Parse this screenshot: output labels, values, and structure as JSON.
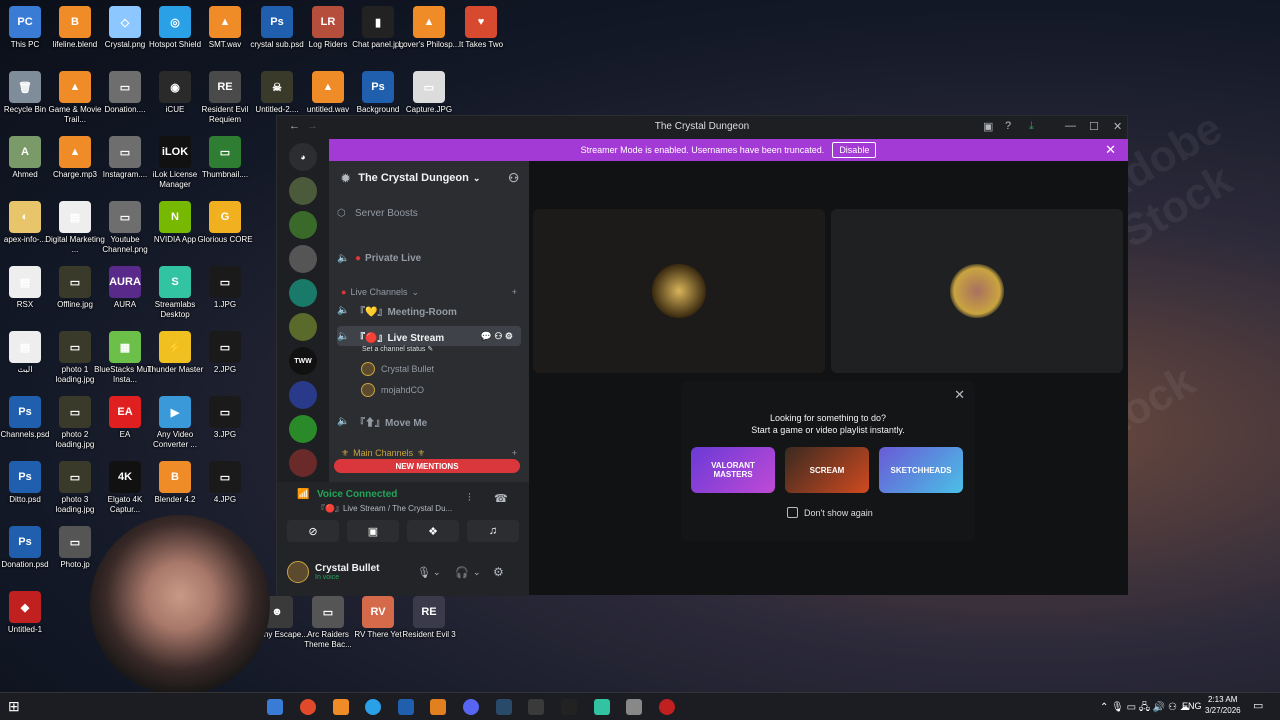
{
  "desktop": {
    "icons": [
      {
        "label": "This PC",
        "color": "#3a7bd5",
        "glyph": "PC"
      },
      {
        "label": "lifeline.blend",
        "color": "#f08c28",
        "glyph": "B"
      },
      {
        "label": "Crystal.png",
        "color": "#8cc8ff",
        "glyph": "◇"
      },
      {
        "label": "Hotspot Shield",
        "color": "#2aa0e6",
        "glyph": "◎"
      },
      {
        "label": "SMT.wav",
        "color": "#f08c28",
        "glyph": "▲"
      },
      {
        "label": "crystal sub.psd",
        "color": "#1f5fae",
        "glyph": "Ps"
      },
      {
        "label": "Log Riders",
        "color": "#b54f3b",
        "glyph": "LR"
      },
      {
        "label": "Chat panel.jpg",
        "color": "#222222",
        "glyph": "▮"
      },
      {
        "label": "Lover's Philosp...",
        "color": "#f08c28",
        "glyph": "▲"
      },
      {
        "label": "It Takes Two",
        "color": "#d84a2f",
        "glyph": "♥"
      },
      {
        "label": "Recycle Bin",
        "color": "#7f8c99",
        "glyph": "🗑"
      },
      {
        "label": "Game & Movie Trail...",
        "color": "#f08c28",
        "glyph": "▲"
      },
      {
        "label": "Donation....",
        "color": "#6e6e6e",
        "glyph": "▭"
      },
      {
        "label": "iCUE",
        "color": "#2a2a2a",
        "glyph": "◉"
      },
      {
        "label": "Resident Evil Requiem",
        "color": "#4a4a4a",
        "glyph": "RE"
      },
      {
        "label": "Untitled-2....",
        "color": "#3a3a2a",
        "glyph": "☠"
      },
      {
        "label": "untitled.wav",
        "color": "#f08c28",
        "glyph": "▲"
      },
      {
        "label": "Background",
        "color": "#1f5fae",
        "glyph": "Ps"
      },
      {
        "label": "Capture.JPG",
        "color": "#dcdcdc",
        "glyph": "▭"
      },
      {
        "label": "Ahmed",
        "color": "#7a9a6a",
        "glyph": "A"
      },
      {
        "label": "Charge.mp3",
        "color": "#f08c28",
        "glyph": "▲"
      },
      {
        "label": "Instagram....",
        "color": "#6e6e6e",
        "glyph": "▭"
      },
      {
        "label": "iLok License Manager",
        "color": "#111111",
        "glyph": "iLOK"
      },
      {
        "label": "Thumbnail....",
        "color": "#2e7d32",
        "glyph": "▭"
      },
      {
        "label": "apex-info-...",
        "color": "#e8c46a",
        "glyph": "◐"
      },
      {
        "label": "Digital Marketing ...",
        "color": "#eeeeee",
        "glyph": "▤"
      },
      {
        "label": "Youtube Channel.png",
        "color": "#6e6e6e",
        "glyph": "▭"
      },
      {
        "label": "NVIDIA App",
        "color": "#76b900",
        "glyph": "N"
      },
      {
        "label": "Glorious CORE",
        "color": "#f0b020",
        "glyph": "G"
      },
      {
        "label": "RSX",
        "color": "#eeeeee",
        "glyph": "▤"
      },
      {
        "label": "Offline.jpg",
        "color": "#3a3a2a",
        "glyph": "▭"
      },
      {
        "label": "AURA",
        "color": "#5a2a8a",
        "glyph": "AURA"
      },
      {
        "label": "Streamlabs Desktop",
        "color": "#31c3a2",
        "glyph": "S"
      },
      {
        "label": "1.JPG",
        "color": "#1a1a1a",
        "glyph": "▭"
      },
      {
        "label": "البث",
        "color": "#eeeeee",
        "glyph": "▤"
      },
      {
        "label": "photo 1 loading.jpg",
        "color": "#3a3a2a",
        "glyph": "▭"
      },
      {
        "label": "BlueStacks Multi-Insta...",
        "color": "#6cc04a",
        "glyph": "▦"
      },
      {
        "label": "Thunder Master",
        "color": "#f0c020",
        "glyph": "⚡"
      },
      {
        "label": "2.JPG",
        "color": "#1a1a1a",
        "glyph": "▭"
      },
      {
        "label": "Channels.psd",
        "color": "#1f5fae",
        "glyph": "Ps"
      },
      {
        "label": "photo 2 loading.jpg",
        "color": "#3a3a2a",
        "glyph": "▭"
      },
      {
        "label": "EA",
        "color": "#e02020",
        "glyph": "EA"
      },
      {
        "label": "Any Video Converter ...",
        "color": "#3a9ad9",
        "glyph": "▶"
      },
      {
        "label": "3.JPG",
        "color": "#1a1a1a",
        "glyph": "▭"
      },
      {
        "label": "Ditto.psd",
        "color": "#1f5fae",
        "glyph": "Ps"
      },
      {
        "label": "photo 3 loading.jpg",
        "color": "#3a3a2a",
        "glyph": "▭"
      },
      {
        "label": "Elgato 4K Captur...",
        "color": "#111111",
        "glyph": "4K"
      },
      {
        "label": "Blender 4.2",
        "color": "#f08c28",
        "glyph": "B"
      },
      {
        "label": "4.JPG",
        "color": "#1a1a1a",
        "glyph": "▭"
      },
      {
        "label": "Donation.psd",
        "color": "#1f5fae",
        "glyph": "Ps"
      },
      {
        "label": "Photo.jp",
        "color": "#555555",
        "glyph": "▭"
      },
      {
        "label": "Untitled-1",
        "color": "#c02020",
        "glyph": "◆"
      },
      {
        "label": "Granny Escape...",
        "color": "#3a3a3a",
        "glyph": "☻"
      },
      {
        "label": "Arc Raiders Theme Bac...",
        "color": "#555555",
        "glyph": "▭"
      },
      {
        "label": "RV There Yet",
        "color": "#d46a4a",
        "glyph": "RV"
      },
      {
        "label": "Resident Evil 3",
        "color": "#3a3a4a",
        "glyph": "RE"
      }
    ]
  },
  "discord": {
    "window_title": "The Crystal Dungeon",
    "banner": {
      "text": "Streamer Mode is enabled. Usernames have been truncated.",
      "disable_label": "Disable"
    },
    "server_name": "The Crystal Dungeon",
    "server_boosts": "Server Boosts",
    "channels": {
      "private_live": "Private Live",
      "live_category": "Live Channels",
      "meeting_room": "『💛』Meeting-Room",
      "live_stream": "『🔴』Live Stream",
      "set_status": "Set a channel status",
      "members": [
        "Crystal Bullet",
        "mojahdCO"
      ],
      "move_me": "『⬆』Move Me",
      "main_category": "Main Channels",
      "new_mentions": "NEW MENTIONS"
    },
    "voice": {
      "status": "Voice Connected",
      "channel": "『🔴』Live Stream / The Crystal Du..."
    },
    "user": {
      "name": "Crystal Bullet",
      "status": "In voice"
    },
    "activity": {
      "line1": "Looking for something to do?",
      "line2": "Start a game or video playlist instantly.",
      "games": [
        "VALORANT MASTERS",
        "SCREAM",
        "SKETCHHEADS"
      ],
      "dont_show": "Don't show again"
    }
  },
  "taskbar": {
    "lang": "ENG",
    "time": "2:13 AM",
    "date": "3/27/2026"
  },
  "watermark": "Adobe Stock"
}
